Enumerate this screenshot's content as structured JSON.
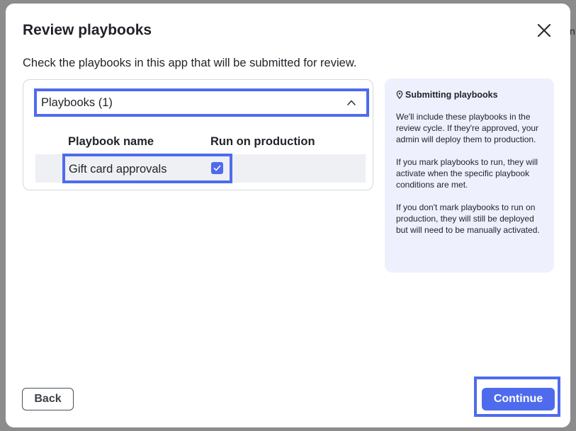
{
  "background": {
    "peek_text": "n"
  },
  "modal": {
    "title": "Review playbooks",
    "subtitle": "Check the playbooks in this app that will be submitted for review.",
    "close_icon": "close-icon"
  },
  "playbooks_section": {
    "header": "Playbooks (1)",
    "expanded": true,
    "columns": [
      "Playbook name",
      "Run on production"
    ],
    "rows": [
      {
        "name": "Gift card approvals",
        "run_on_production": true
      }
    ]
  },
  "info_panel": {
    "icon": "location-pin-icon",
    "title": "Submitting playbooks",
    "paragraphs": [
      "We'll include these playbooks in the review cycle. If they're approved, your admin will deploy them to production.",
      "If you mark playbooks to run, they will activate when the specific playbook conditions are met.",
      "If you don't mark playbooks to run on production, they will still be deployed but will need to be manually activated."
    ]
  },
  "footer": {
    "back_label": "Back",
    "continue_label": "Continue"
  },
  "colors": {
    "accent": "#4f6bed",
    "info_background": "#eef0fd",
    "row_background": "#eef0f3"
  }
}
